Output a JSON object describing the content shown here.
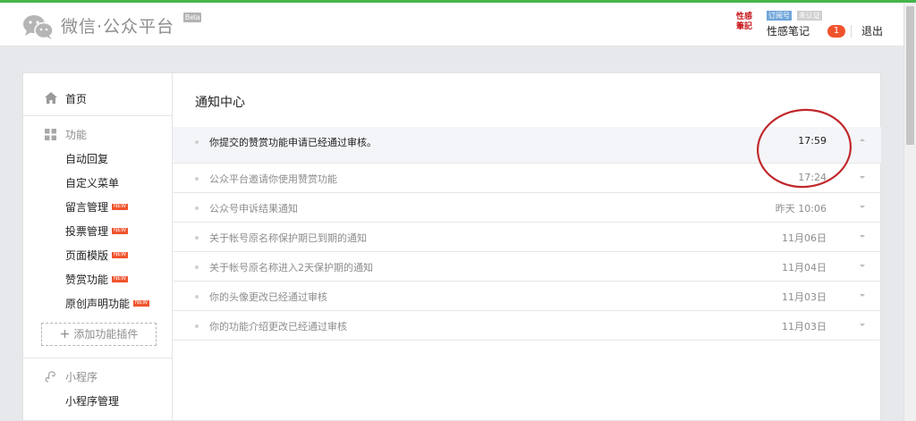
{
  "header": {
    "brand": "微信·公众平台",
    "beta": "Beta",
    "account_logo_text": "性感\n筆記",
    "badge_subscription": "订阅号",
    "badge_unverified": "未认证",
    "account_name": "性感笔记",
    "notification_count": "1",
    "logout": "退出",
    "accent_color": "#44b549",
    "badge_color": "#f0542d"
  },
  "sidebar": {
    "home": "首页",
    "features_group": "功能",
    "features": [
      {
        "label": "自动回复",
        "new": false
      },
      {
        "label": "自定义菜单",
        "new": false
      },
      {
        "label": "留言管理",
        "new": true
      },
      {
        "label": "投票管理",
        "new": true
      },
      {
        "label": "页面模版",
        "new": true
      },
      {
        "label": "赞赏功能",
        "new": true
      },
      {
        "label": "原创声明功能",
        "new": true
      }
    ],
    "new_tag": "NEW",
    "add_plugin": "添加功能插件",
    "miniprogram_group": "小程序",
    "miniprogram_items": [
      "小程序管理"
    ]
  },
  "main": {
    "title": "通知中心",
    "notifications": [
      {
        "title": "你提交的赞赏功能申请已经通过审核。",
        "time": "17:59",
        "expanded": true
      },
      {
        "title": "公众平台邀请你使用赞赏功能",
        "time": "17:24",
        "expanded": false
      },
      {
        "title": "公众号申诉结果通知",
        "time": "昨天 10:06",
        "expanded": false
      },
      {
        "title": "关于帐号原名称保护期已到期的通知",
        "time": "11月06日",
        "expanded": false
      },
      {
        "title": "关于帐号原名称进入2天保护期的通知",
        "time": "11月04日",
        "expanded": false
      },
      {
        "title": "你的头像更改已经通过审核",
        "time": "11月03日",
        "expanded": false
      },
      {
        "title": "你的功能介绍更改已经通过审核",
        "time": "11月03日",
        "expanded": false
      }
    ]
  }
}
